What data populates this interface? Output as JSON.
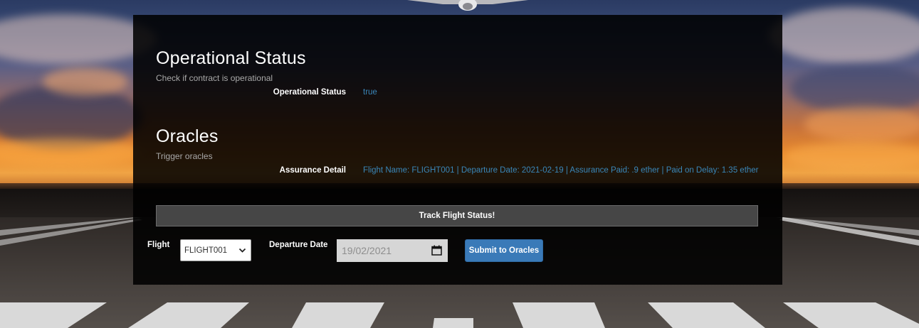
{
  "operational": {
    "title": "Operational Status",
    "subtitle": "Check if contract is operational",
    "field_label": "Operational Status",
    "field_value": "true"
  },
  "oracles": {
    "title": "Oracles",
    "subtitle": "Trigger oracles",
    "field_label": "Assurance Detail",
    "field_value": "Flight Name: FLIGHT001 | Departure Date: 2021-02-19 | Assurance Paid: .9 ether | Paid on Delay: 1.35 ether"
  },
  "track_bar_label": "Track Flight Status!",
  "form": {
    "flight_label": "Flight",
    "flight_selected": "FLIGHT001",
    "departure_label": "Departure Date",
    "departure_value": "19/02/2021",
    "submit_label": "Submit to Oracles"
  },
  "icons": {
    "select": "chevron-down-icon",
    "date": "calendar-icon"
  },
  "colors": {
    "value_text": "#3a86b8",
    "button": "#3a7ab8",
    "panel": "rgba(0,0,0,0.87)"
  }
}
